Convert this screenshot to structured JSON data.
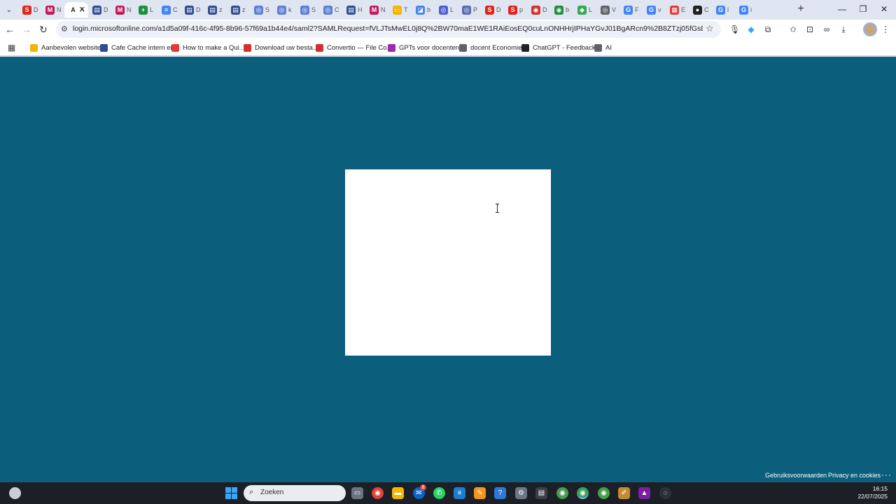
{
  "browser": {
    "url": "login.microsoftonline.com/a1d5a09f-416c-4f95-8b96-57f69a1b44e4/saml2?SAMLRequest=fVLJTsMwEL0j8Q%2BW70maE1WE1RAiEosEQ0cuLnONHHrjIPHaYGvJ01BgARcn9%2B8ZTzj05fGsDU40hZTHocjzgCVLTVWKX8...",
    "tabs": [
      {
        "fav": "S",
        "color": "#e2231a",
        "label": "D"
      },
      {
        "fav": "M",
        "color": "#c2185b",
        "label": "N"
      },
      {
        "fav": "A",
        "color": "#ffffff",
        "label": "A",
        "active": true
      },
      {
        "fav": "▤",
        "color": "#2f4b94",
        "label": "D"
      },
      {
        "fav": "M",
        "color": "#c2185b",
        "label": "N"
      },
      {
        "fav": "+",
        "color": "#1e8e3e",
        "label": "L"
      },
      {
        "fav": "≡",
        "color": "#4285f4",
        "label": "C"
      },
      {
        "fav": "▤",
        "color": "#2f4b94",
        "label": "D"
      },
      {
        "fav": "▤",
        "color": "#2f4b94",
        "label": "z"
      },
      {
        "fav": "▤",
        "color": "#2f4b94",
        "label": "z"
      },
      {
        "fav": "◎",
        "color": "#5b7fd6",
        "label": "S"
      },
      {
        "fav": "◎",
        "color": "#5b7fd6",
        "label": "k"
      },
      {
        "fav": "◎",
        "color": "#5b7fd6",
        "label": "S"
      },
      {
        "fav": "◎",
        "color": "#5b7fd6",
        "label": "C"
      },
      {
        "fav": "▤",
        "color": "#2f4b94",
        "label": "H"
      },
      {
        "fav": "M",
        "color": "#c2185b",
        "label": "N"
      },
      {
        "fav": "▭",
        "color": "#f4b400",
        "label": "T"
      },
      {
        "fav": "◪",
        "color": "#4285f4",
        "label": "b"
      },
      {
        "fav": "◎",
        "color": "#4c5fd7",
        "label": "L"
      },
      {
        "fav": "◎",
        "color": "#5b6bb0",
        "label": "P"
      },
      {
        "fav": "S",
        "color": "#e2231a",
        "label": "D"
      },
      {
        "fav": "S",
        "color": "#e2231a",
        "label": "p"
      },
      {
        "fav": "◉",
        "color": "#d32f2f",
        "label": "D"
      },
      {
        "fav": "◉",
        "color": "#1e8e3e",
        "label": "b"
      },
      {
        "fav": "◆",
        "color": "#34a853",
        "label": "L"
      },
      {
        "fav": "◎",
        "color": "#5f6368",
        "label": "V"
      },
      {
        "fav": "G",
        "color": "#4285f4",
        "label": "F"
      },
      {
        "fav": "G",
        "color": "#4285f4",
        "label": "v"
      },
      {
        "fav": "▦",
        "color": "#e53935",
        "label": "E"
      },
      {
        "fav": "●",
        "color": "#202124",
        "label": "C"
      },
      {
        "fav": "G",
        "color": "#4285f4",
        "label": "l"
      },
      {
        "fav": "G",
        "color": "#4285f4",
        "label": "i"
      }
    ],
    "bookmarks": [
      {
        "label": "Aanbevolen websites",
        "color": "#f4b400"
      },
      {
        "label": "Cafe Cache intern ei...",
        "color": "#2f4b94"
      },
      {
        "label": "How to make a Qui...",
        "color": "#e53935"
      },
      {
        "label": "Download uw besta...",
        "color": "#d32f2f"
      },
      {
        "label": "Convertio — File Co...",
        "color": "#d32f2f"
      },
      {
        "label": "GPTs voor docenten...",
        "color": "#9c27b0"
      },
      {
        "label": "docent Economie",
        "color": "#5f6368"
      },
      {
        "label": "ChatGPT - Feedback...",
        "color": "#202124"
      },
      {
        "label": "AI",
        "color": "#5f6368"
      }
    ]
  },
  "page": {
    "footer_terms": "Gebruiksvoorwaarden",
    "footer_privacy": "Privacy en cookies",
    "footer_more": "···"
  },
  "taskbar": {
    "search_placeholder": "Zoeken",
    "time": "16:15",
    "date": "22/07/2025",
    "mail_badge": "8"
  }
}
